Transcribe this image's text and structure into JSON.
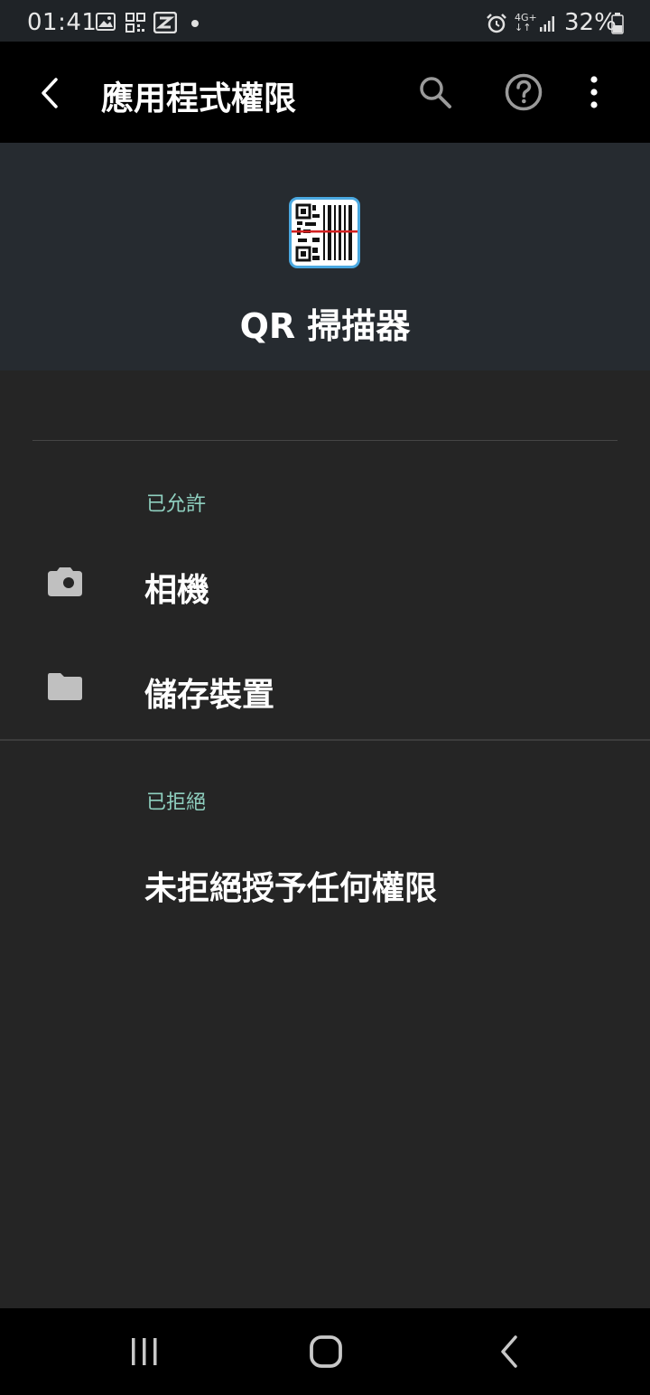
{
  "status_bar": {
    "time": "01:41",
    "network": "4G+",
    "battery": "32%"
  },
  "app_bar": {
    "title": "應用程式權限",
    "icons": [
      "back-icon",
      "search-icon",
      "help-icon",
      "more-vert-icon"
    ]
  },
  "app": {
    "name": "QR 掃描器",
    "icon": "qr-scanner-app-icon"
  },
  "allowed": {
    "label": "已允許",
    "items": [
      {
        "label": "相機",
        "icon": "camera-icon"
      },
      {
        "label": "儲存裝置",
        "icon": "folder-icon"
      }
    ]
  },
  "denied": {
    "label": "已拒絕",
    "empty_text": "未拒絕授予任何權限"
  },
  "colors": {
    "accent": "#8fd0c0",
    "header_bg": "#262b30",
    "content_bg": "#252525",
    "app_icon_border": "#4aa8e0"
  }
}
